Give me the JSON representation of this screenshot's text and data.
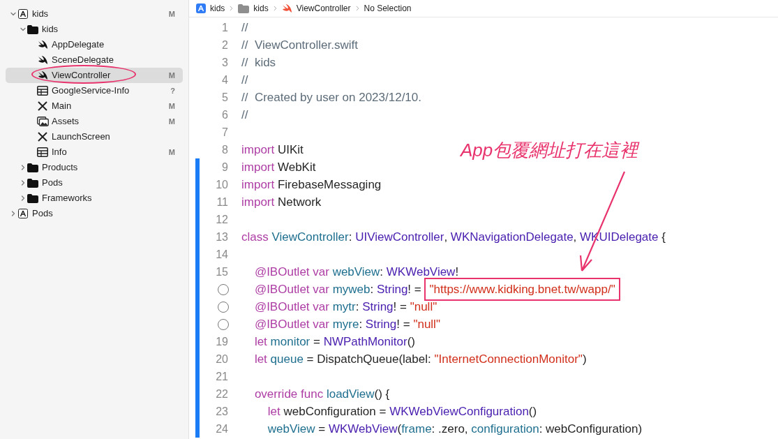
{
  "navigator": {
    "items": [
      {
        "label": "kids",
        "kind": "project",
        "badge": "M",
        "expanded": true,
        "selected": false,
        "children": [
          {
            "label": "kids",
            "kind": "folder",
            "expanded": true,
            "selected": false,
            "children": [
              {
                "label": "AppDelegate",
                "kind": "swift",
                "selected": false
              },
              {
                "label": "SceneDelegate",
                "kind": "swift",
                "selected": false
              },
              {
                "label": "ViewController",
                "kind": "swift",
                "badge": "M",
                "selected": true,
                "circled": true
              },
              {
                "label": "GoogleService-Info",
                "kind": "plist",
                "badge": "?",
                "selected": false
              },
              {
                "label": "Main",
                "kind": "storyboard",
                "badge": "M",
                "selected": false
              },
              {
                "label": "Assets",
                "kind": "assets",
                "badge": "M",
                "selected": false
              },
              {
                "label": "LaunchScreen",
                "kind": "storyboard",
                "selected": false
              },
              {
                "label": "Info",
                "kind": "plist",
                "badge": "M",
                "selected": false
              }
            ]
          },
          {
            "label": "Products",
            "kind": "folder",
            "expanded": false,
            "selected": false
          },
          {
            "label": "Pods",
            "kind": "folder",
            "expanded": false,
            "selected": false
          },
          {
            "label": "Frameworks",
            "kind": "folder",
            "expanded": false,
            "selected": false
          }
        ]
      },
      {
        "label": "Pods",
        "kind": "project",
        "expanded": false,
        "selected": false
      }
    ]
  },
  "breadcrumb": [
    {
      "label": "kids",
      "kind": "project"
    },
    {
      "label": "kids",
      "kind": "folder"
    },
    {
      "label": "ViewController",
      "kind": "swift"
    },
    {
      "label": "No Selection",
      "kind": "none"
    }
  ],
  "editor": {
    "lines": [
      {
        "kind": "number",
        "number": "1",
        "changed": false,
        "tokens": [
          {
            "kind": "comment",
            "text": "//"
          }
        ]
      },
      {
        "kind": "number",
        "number": "2",
        "changed": false,
        "tokens": [
          {
            "kind": "comment",
            "text": "//  ViewController.swift"
          }
        ]
      },
      {
        "kind": "number",
        "number": "3",
        "changed": false,
        "tokens": [
          {
            "kind": "comment",
            "text": "//  kids"
          }
        ]
      },
      {
        "kind": "number",
        "number": "4",
        "changed": false,
        "tokens": [
          {
            "kind": "comment",
            "text": "//"
          }
        ]
      },
      {
        "kind": "number",
        "number": "5",
        "changed": false,
        "tokens": [
          {
            "kind": "comment",
            "text": "//  Created by user on 2023/12/10."
          }
        ]
      },
      {
        "kind": "number",
        "number": "6",
        "changed": false,
        "tokens": [
          {
            "kind": "comment",
            "text": "//"
          }
        ]
      },
      {
        "kind": "number",
        "number": "7",
        "changed": false
      },
      {
        "kind": "number",
        "number": "8",
        "changed": false,
        "tokens": [
          {
            "kind": "keyword",
            "text": "import"
          },
          {
            "kind": "plain",
            "text": " UIKit"
          }
        ]
      },
      {
        "kind": "number",
        "number": "9",
        "changed": true,
        "tokens": [
          {
            "kind": "keyword",
            "text": "import"
          },
          {
            "kind": "plain",
            "text": " WebKit"
          }
        ]
      },
      {
        "kind": "number",
        "number": "10",
        "changed": true,
        "tokens": [
          {
            "kind": "keyword",
            "text": "import"
          },
          {
            "kind": "plain",
            "text": " FirebaseMessaging"
          }
        ]
      },
      {
        "kind": "number",
        "number": "11",
        "changed": true,
        "tokens": [
          {
            "kind": "keyword",
            "text": "import"
          },
          {
            "kind": "plain",
            "text": " Network"
          }
        ]
      },
      {
        "kind": "number",
        "number": "12",
        "changed": true
      },
      {
        "kind": "number",
        "number": "13",
        "changed": true,
        "tokens": [
          {
            "kind": "keyword",
            "text": "class"
          },
          {
            "kind": "name",
            "text": " ViewController"
          },
          {
            "kind": "plain",
            "text": ": "
          },
          {
            "kind": "type",
            "text": "UIViewController"
          },
          {
            "kind": "plain",
            "text": ", "
          },
          {
            "kind": "type",
            "text": "WKNavigationDelegate"
          },
          {
            "kind": "plain",
            "text": ", "
          },
          {
            "kind": "type",
            "text": "WKUIDelegate"
          },
          {
            "kind": "plain",
            "text": " {"
          }
        ]
      },
      {
        "kind": "number",
        "number": "14",
        "changed": true
      },
      {
        "kind": "number",
        "number": "15",
        "changed": true,
        "tokens": [
          {
            "kind": "keyword",
            "text": "    @IBOutlet var"
          },
          {
            "kind": "name",
            "text": " webView"
          },
          {
            "kind": "plain",
            "text": ": "
          },
          {
            "kind": "type",
            "text": "WKWebView"
          },
          {
            "kind": "plain",
            "text": "!"
          }
        ]
      },
      {
        "kind": "outlet",
        "changed": true,
        "tokens": [
          {
            "kind": "keyword",
            "text": "    @IBOutlet var"
          },
          {
            "kind": "name",
            "text": " myweb"
          },
          {
            "kind": "plain",
            "text": ": "
          },
          {
            "kind": "type",
            "text": "String"
          },
          {
            "kind": "plain",
            "text": "! = "
          },
          {
            "kind": "string",
            "text": "\"https://www.kidking.bnet.tw/wapp/\"",
            "boxed": true
          }
        ]
      },
      {
        "kind": "outlet",
        "changed": true,
        "tokens": [
          {
            "kind": "keyword",
            "text": "    @IBOutlet var"
          },
          {
            "kind": "name",
            "text": " mytr"
          },
          {
            "kind": "plain",
            "text": ": "
          },
          {
            "kind": "type",
            "text": "String"
          },
          {
            "kind": "plain",
            "text": "! = "
          },
          {
            "kind": "string",
            "text": "\"null\""
          }
        ]
      },
      {
        "kind": "outlet",
        "changed": true,
        "tokens": [
          {
            "kind": "keyword",
            "text": "    @IBOutlet var"
          },
          {
            "kind": "name",
            "text": " myre"
          },
          {
            "kind": "plain",
            "text": ": "
          },
          {
            "kind": "type",
            "text": "String"
          },
          {
            "kind": "plain",
            "text": "! = "
          },
          {
            "kind": "string",
            "text": "\"null\""
          }
        ]
      },
      {
        "kind": "number",
        "number": "19",
        "changed": true,
        "tokens": [
          {
            "kind": "keyword",
            "text": "    let"
          },
          {
            "kind": "name",
            "text": " monitor"
          },
          {
            "kind": "plain",
            "text": " = "
          },
          {
            "kind": "type",
            "text": "NWPathMonitor"
          },
          {
            "kind": "plain",
            "text": "()"
          }
        ]
      },
      {
        "kind": "number",
        "number": "20",
        "changed": true,
        "tokens": [
          {
            "kind": "keyword",
            "text": "    let"
          },
          {
            "kind": "name",
            "text": " queue"
          },
          {
            "kind": "plain",
            "text": " = DispatchQueue(label: "
          },
          {
            "kind": "string",
            "text": "\"InternetConnectionMonitor\""
          },
          {
            "kind": "plain",
            "text": ")"
          }
        ]
      },
      {
        "kind": "number",
        "number": "21",
        "changed": true
      },
      {
        "kind": "number",
        "number": "22",
        "changed": true,
        "tokens": [
          {
            "kind": "keyword",
            "text": "    override func"
          },
          {
            "kind": "name",
            "text": " loadView"
          },
          {
            "kind": "plain",
            "text": "() {"
          }
        ]
      },
      {
        "kind": "number",
        "number": "23",
        "changed": true,
        "tokens": [
          {
            "kind": "keyword",
            "text": "        let"
          },
          {
            "kind": "plain",
            "text": " webConfiguration = "
          },
          {
            "kind": "type",
            "text": "WKWebViewConfiguration"
          },
          {
            "kind": "plain",
            "text": "()"
          }
        ]
      },
      {
        "kind": "number",
        "number": "24",
        "changed": true,
        "tokens": [
          {
            "kind": "name",
            "text": "        webView"
          },
          {
            "kind": "plain",
            "text": " = "
          },
          {
            "kind": "type",
            "text": "WKWebView"
          },
          {
            "kind": "plain",
            "text": "("
          },
          {
            "kind": "name",
            "text": "frame"
          },
          {
            "kind": "plain",
            "text": ": .zero, "
          },
          {
            "kind": "name",
            "text": "configuration"
          },
          {
            "kind": "plain",
            "text": ": webConfiguration)"
          }
        ]
      }
    ]
  },
  "annotation": {
    "note": "App包覆網址打在這裡"
  }
}
